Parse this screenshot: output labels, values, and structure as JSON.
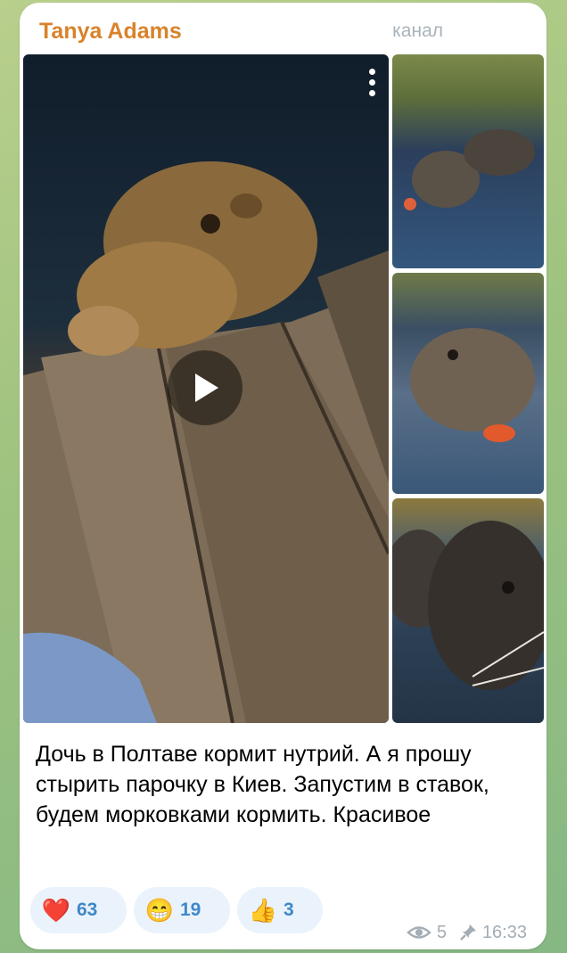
{
  "post": {
    "author": "Tanya Adams",
    "role": "канал",
    "caption": "Дочь в Полтаве кормит нутрий. А я прошу стырить парочку в Киев. Запустим в ставок, будем морковками кормить. Красивое"
  },
  "reactions": [
    {
      "emoji": "❤️",
      "count": "63"
    },
    {
      "emoji": "😁",
      "count": "19"
    },
    {
      "emoji": "👍",
      "count": "3"
    }
  ],
  "meta": {
    "views": "5",
    "time": "16:33"
  },
  "colors": {
    "author": "#d9822b",
    "reaction_bg": "#eaf3fb",
    "reaction_text": "#3e88c8"
  }
}
